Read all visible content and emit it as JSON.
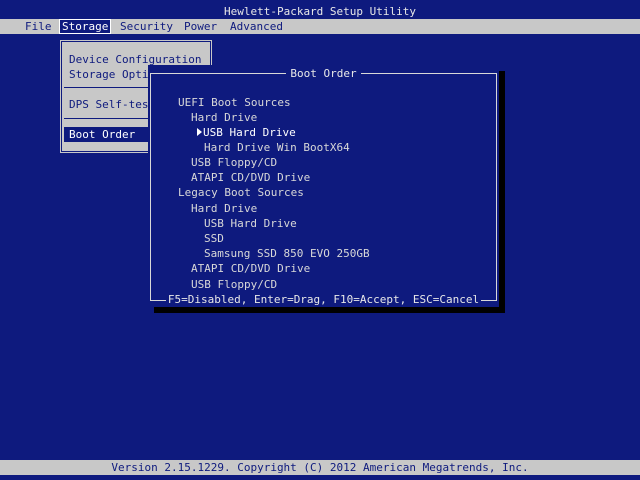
{
  "window": {
    "title": "Hewlett-Packard Setup Utility"
  },
  "menubar": {
    "items": [
      {
        "label": "File"
      },
      {
        "label": "Storage"
      },
      {
        "label": "Security"
      },
      {
        "label": "Power"
      },
      {
        "label": "Advanced"
      }
    ],
    "selected": "Storage"
  },
  "storage_menu": {
    "items": [
      {
        "label": "Device Configuration"
      },
      {
        "label": "Storage Opti"
      },
      {
        "label": "DPS Self-tes"
      },
      {
        "label": "Boot Order"
      }
    ],
    "selected": "Boot Order"
  },
  "boot_order_dialog": {
    "title": "Boot Order",
    "entries": [
      {
        "label": "UEFI Boot Sources",
        "level": 0
      },
      {
        "label": "Hard Drive",
        "level": 1
      },
      {
        "label": "USB Hard Drive",
        "level": 2,
        "current": true
      },
      {
        "label": "Hard Drive Win BootX64",
        "level": 2
      },
      {
        "label": "USB Floppy/CD",
        "level": 1
      },
      {
        "label": "ATAPI CD/DVD Drive",
        "level": 1
      },
      {
        "label": "Legacy Boot Sources",
        "level": 0
      },
      {
        "label": "Hard Drive",
        "level": 1
      },
      {
        "label": "USB Hard Drive",
        "level": 2
      },
      {
        "label": "SSD",
        "level": 2
      },
      {
        "label": "Samsung SSD 850 EVO 250GB",
        "level": 2
      },
      {
        "label": "ATAPI CD/DVD Drive",
        "level": 1
      },
      {
        "label": "USB Floppy/CD",
        "level": 1
      }
    ],
    "pointer_icon": "right-triangle-pointer",
    "footer": "F5=Disabled, Enter=Drag, F10=Accept, ESC=Cancel"
  },
  "statusbar": {
    "text": "Version 2.15.1229. Copyright (C) 2012 American Megatrends, Inc."
  },
  "colors": {
    "background": "#0e1a7e",
    "bar": "#c8c8c8",
    "text": "#d8d8d8",
    "highlight": "#ffffff"
  }
}
